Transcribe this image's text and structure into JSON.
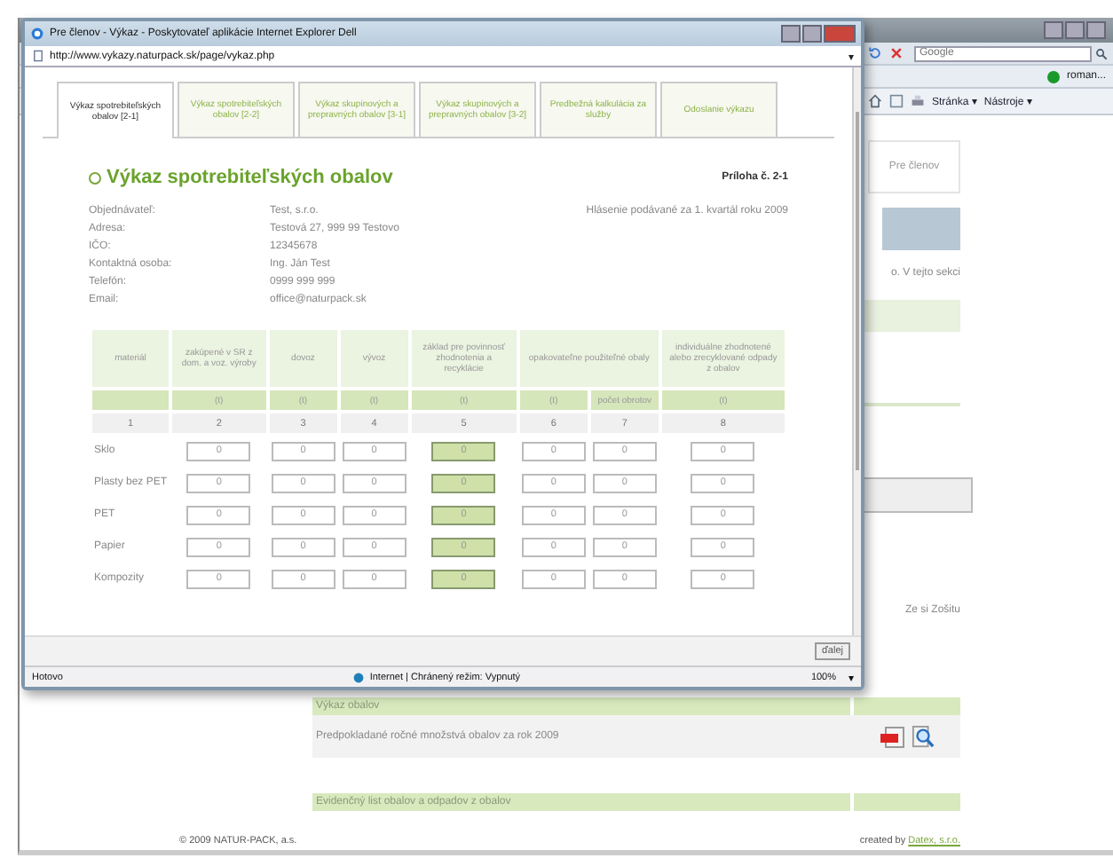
{
  "background": {
    "search": {
      "placeholder": "Google"
    },
    "user": "roman...",
    "toolbar": [
      "Stránka ▾",
      "Nástroje ▾"
    ],
    "page_tab": "Pre členov",
    "snippet": "o. V tejto sekci",
    "snippet_2": "Ze si Zošitu",
    "sections": [
      {
        "title": "Výkaz obalov",
        "rows": [
          "Predpokladané ročné množstvá obalov za rok 2009"
        ]
      },
      {
        "title": "Evidenčný list obalov a odpadov z obalov"
      }
    ],
    "footer": {
      "copyright": "© 2009 NATUR-PACK, a.s.",
      "credit": "created by",
      "credit_link": "Datex, s.r.o."
    }
  },
  "window": {
    "title": "Pre členov - Výkaz - Poskytovateľ aplikácie Internet Explorer Dell",
    "address": "http://www.vykazy.naturpack.sk/page/vykaz.php",
    "address_menu": "▾"
  },
  "tabs": [
    {
      "label": "Výkaz spotrebiteľských obalov [2-1]",
      "selected": true
    },
    {
      "label": "Výkaz spotrebiteľských obalov [2-2]",
      "selected": false
    },
    {
      "label": "Výkaz skupinových a prepravných obalov [3-1]",
      "selected": false
    },
    {
      "label": "Výkaz skupinových a prepravných obalov [3-2]",
      "selected": false
    },
    {
      "label": "Predbežná kalkulácia za služby",
      "selected": false
    },
    {
      "label": "Odoslanie výkazu",
      "selected": false
    }
  ],
  "form": {
    "title": "Výkaz spotrebiteľských obalov",
    "annex": "Príloha č. 2-1",
    "period": "Hlásenie podávané za 1. kvartál roku 2009",
    "fields": [
      {
        "label": "Objednávateľ:",
        "value": "Test, s.r.o."
      },
      {
        "label": "Adresa:",
        "value": "Testová 27, 999 99 Testovo"
      },
      {
        "label": "IČO:",
        "value": "12345678"
      },
      {
        "label": "Kontaktná osoba:",
        "value": "Ing. Ján Test"
      },
      {
        "label": "Telefón:",
        "value": "0999 999 999"
      },
      {
        "label": "Email:",
        "value": "office@naturpack.sk"
      }
    ]
  },
  "table": {
    "headers": [
      {
        "label": "materiál",
        "kind": "single"
      },
      {
        "label": "zakúpené v SR z dom. a voz. výroby",
        "kind": "single"
      },
      {
        "label": "dovoz",
        "kind": "single"
      },
      {
        "label": "vývoz",
        "kind": "single"
      },
      {
        "label": "základ pre povinnosť zhodnotenia a recyklácie",
        "kind": "single"
      },
      {
        "label": "opakovateľne použiteľné obaly",
        "kind": "group"
      },
      {
        "label": "individuálne zhodnotené alebo zrecyklované odpady z obalov",
        "kind": "single"
      }
    ],
    "material_number": "1",
    "columns": [
      {
        "unit": "(t)",
        "number": "2",
        "computed": false
      },
      {
        "unit": "(t)",
        "number": "3",
        "computed": false
      },
      {
        "unit": "(t)",
        "number": "4",
        "computed": false
      },
      {
        "unit": "(t)",
        "number": "5",
        "computed": true
      },
      {
        "unit": "(t)",
        "number": "6",
        "computed": false
      },
      {
        "unit": "počet obrotov",
        "number": "7",
        "computed": false
      },
      {
        "unit": "(t)",
        "number": "8",
        "computed": false
      }
    ],
    "rows": [
      {
        "material": "Sklo",
        "values": [
          "0",
          "0",
          "0",
          "0",
          "0",
          "0",
          "0"
        ]
      },
      {
        "material": "Plasty bez PET",
        "values": [
          "0",
          "0",
          "0",
          "0",
          "0",
          "0",
          "0"
        ]
      },
      {
        "material": "PET",
        "values": [
          "0",
          "0",
          "0",
          "0",
          "0",
          "0",
          "0"
        ]
      },
      {
        "material": "Papier",
        "values": [
          "0",
          "0",
          "0",
          "0",
          "0",
          "0",
          "0"
        ]
      },
      {
        "material": "Kompozity",
        "values": [
          "0",
          "0",
          "0",
          "0",
          "0",
          "0",
          "0"
        ]
      }
    ]
  },
  "next_button": "ďalej",
  "status_bar": {
    "text": "Hotovo",
    "zone": "Internet | Chránený režim: Vypnutý",
    "zoom": "100%",
    "zoom_menu": "▾"
  }
}
